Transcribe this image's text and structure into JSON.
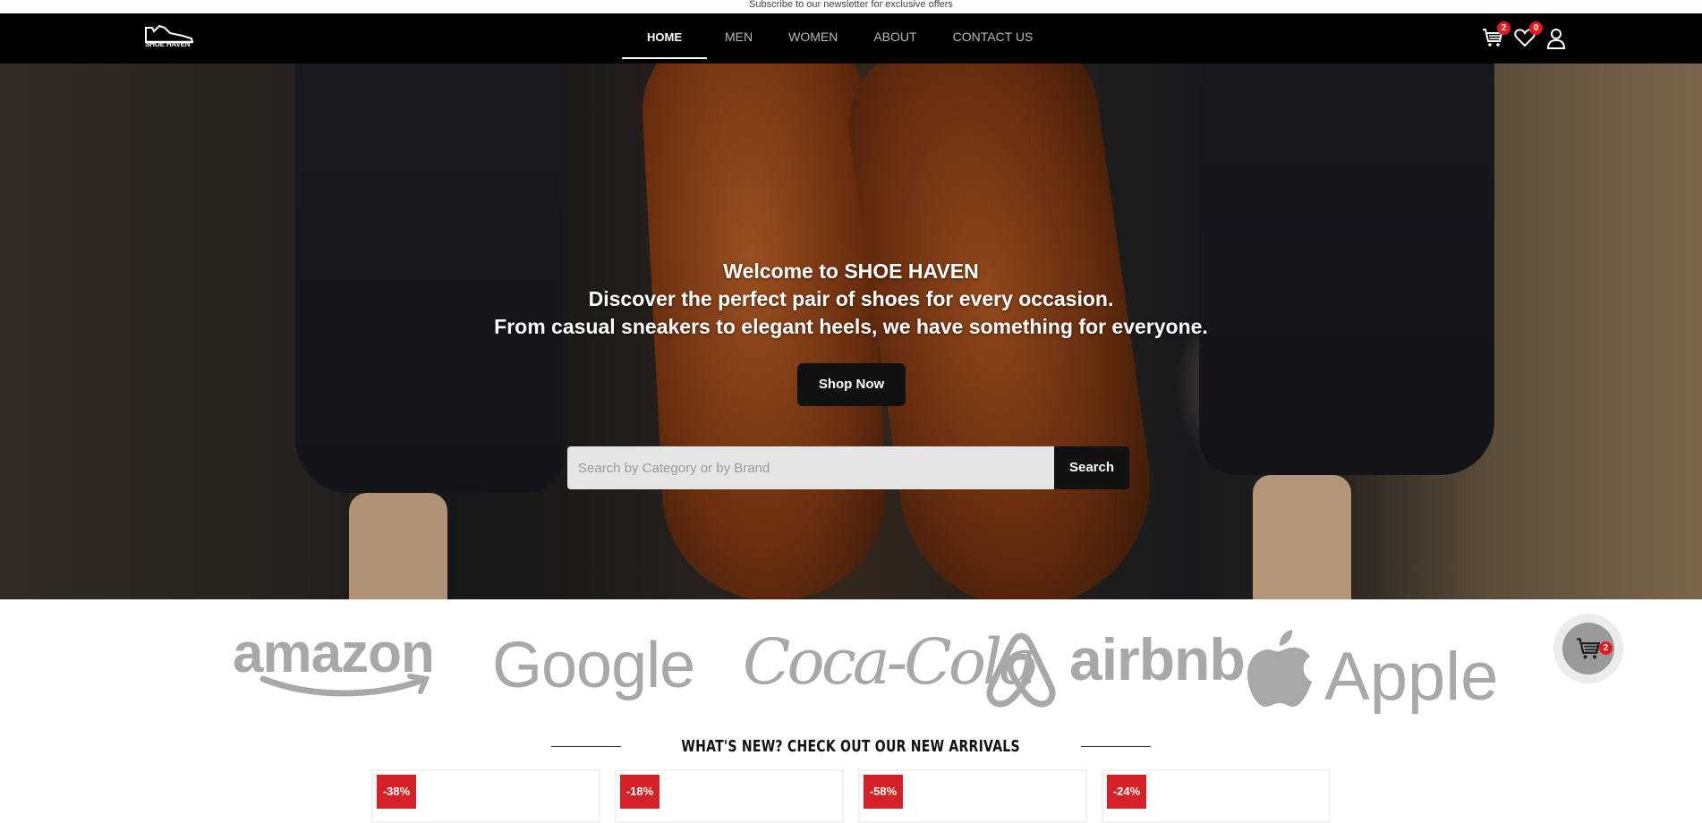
{
  "topbar": {
    "text": "Subscribe to our newsletter for exclusive offers"
  },
  "brand": {
    "logo_text": "SHOE HAVEN"
  },
  "nav": {
    "items": [
      {
        "label": "HOME",
        "active": true
      },
      {
        "label": "MEN",
        "active": false
      },
      {
        "label": "WOMEN",
        "active": false
      },
      {
        "label": "ABOUT",
        "active": false
      },
      {
        "label": "CONTACT US",
        "active": false
      }
    ],
    "cart_count": "2",
    "wishlist_count": "0",
    "icons": [
      "cart-icon",
      "heart-icon",
      "user-icon"
    ]
  },
  "hero": {
    "line1": "Welcome to SHOE HAVEN",
    "line2": "Discover the perfect pair of shoes for every occasion.",
    "line3": "From casual sneakers to elegant heels, we have something for everyone.",
    "cta_label": "Shop Now",
    "search_placeholder": "Search by Category or by Brand",
    "search_value": "",
    "search_button": "Search"
  },
  "brands": [
    "amazon",
    "Google",
    "Coca-Cola",
    "airbnb",
    "Apple"
  ],
  "floating_cart": {
    "count": "2"
  },
  "new_arrivals": {
    "title": "WHAT'S NEW? CHECK OUT OUR NEW ARRIVALS",
    "discounts": [
      "-38%",
      "-18%",
      "-58%",
      "-24%"
    ]
  },
  "colors": {
    "nav_bg": "#000000",
    "badge": "#e51b23",
    "discount_badge": "#d42027",
    "brand_logo_gray": "#a8a8a8"
  }
}
